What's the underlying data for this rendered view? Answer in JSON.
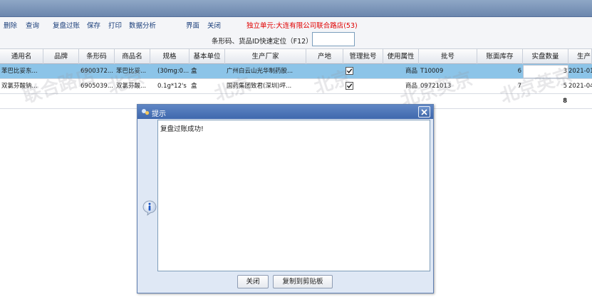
{
  "toolbar": {
    "items": [
      "删除",
      "查询",
      "复盘过账",
      "保存",
      "打印",
      "数据分析",
      "界面",
      "关闭"
    ],
    "unit_label": "独立单元:大连有限公司联合路店(53)"
  },
  "locate": {
    "label": "条形码、货品ID快速定位（F12）",
    "value": ""
  },
  "grid": {
    "headers": [
      "通用名",
      "品牌",
      "条形码",
      "商品名",
      "规格",
      "基本单位",
      "生产厂家",
      "产地",
      "管理批号",
      "使用属性",
      "批号",
      "账面库存",
      "实盘数量",
      "生产"
    ],
    "rows": [
      {
        "generic_name": "苯巴比妥东...",
        "brand": "",
        "barcode": "6900372...",
        "product_name": "苯巴比妥...",
        "spec": "(30mg:0...",
        "unit": "盒",
        "manufacturer": "广州白云山光华制药股...",
        "origin": "",
        "batch_managed": true,
        "usage_attr": "商品",
        "batch_no": "T10009",
        "book_stock": "6",
        "actual_qty": "3",
        "prod_date": "2021-01-"
      },
      {
        "generic_name": "双氯芬酸钠...",
        "brand": "",
        "barcode": "6905039...",
        "product_name": "双氯芬酸...",
        "spec": "0.1g*12's",
        "unit": "盒",
        "manufacturer": "国药集团致君(深圳)坪...",
        "origin": "",
        "batch_managed": true,
        "usage_attr": "商品",
        "batch_no": "09721013",
        "book_stock": "7",
        "actual_qty": "5",
        "prod_date": "2021-04-"
      }
    ],
    "total_actual_qty": "8"
  },
  "dialog": {
    "title": "提示",
    "message": "复盘过账成功!",
    "close_label": "关闭",
    "copy_label": "复制到剪贴板",
    "title_bg": "#4f78bb",
    "info_color": "#1c56c4"
  }
}
